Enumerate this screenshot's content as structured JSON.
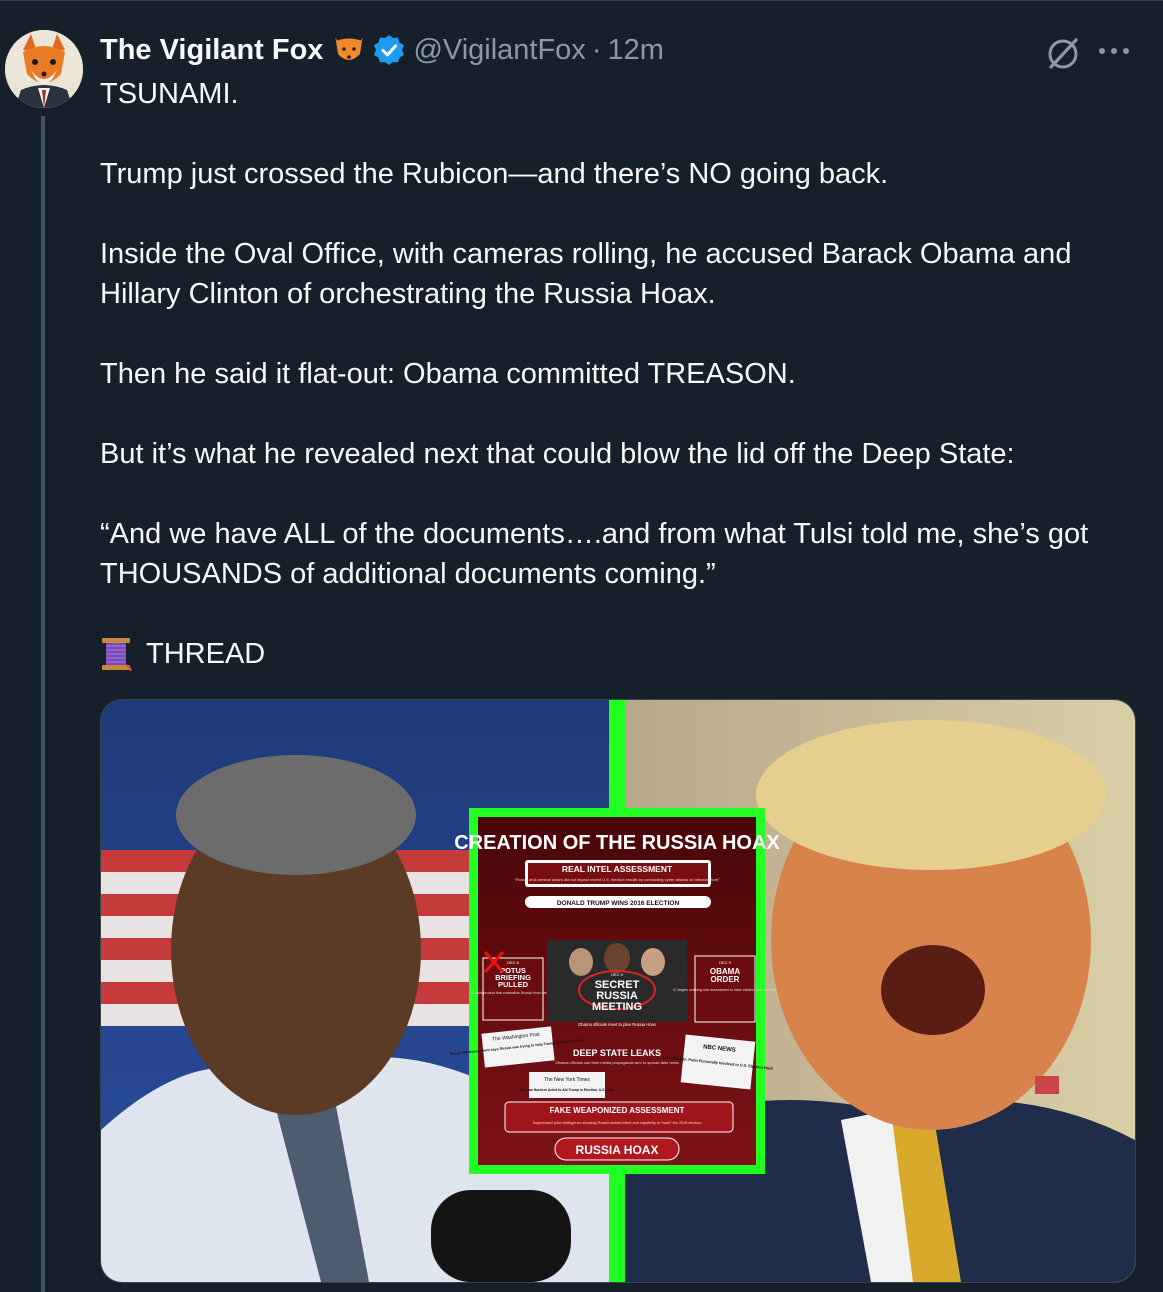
{
  "post": {
    "author_name": "The Vigilant Fox",
    "handle": "@VigilantFox",
    "separator": "·",
    "time": "12m",
    "paragraphs": [
      "TSUNAMI.",
      "Trump just crossed the Rubicon—and there’s NO going back.",
      "Inside the Oval Office, with cameras rolling, he accused Barack Obama and Hillary Clinton of orchestrating the Russia Hoax.",
      "Then he said it flat-out: Obama committed TREASON.",
      "But it’s what he revealed next that could blow the lid off the Deep State:",
      "“And we have ALL of the documents….and from what Tulsi told me, she’s got THOUSANDS of additional documents coming.”"
    ],
    "thread_label": "THREAD"
  },
  "icons": {
    "avatar": "fox-avatar",
    "name_emoji": "fox-face-icon",
    "verified": "verified-badge-icon",
    "grok": "grok-icon",
    "more": "more-dots-icon",
    "thread": "spool-of-thread-icon"
  },
  "colors": {
    "background": "#15202b",
    "text": "#f7f9f9",
    "muted": "#8b98a5",
    "verified_blue": "#1d9bf0",
    "green_frame": "#22ff22",
    "inset_red": "#6b0d10"
  },
  "infographic": {
    "title": "CREATION OF THE RUSSIA HOAX",
    "real_intel": "REAL INTEL ASSESSMENT",
    "real_intel_sub": "“Russia and criminal actors did not impact recent U.S. election results by conducting cyber attacks on infrastructure”",
    "trump_wins": "DONALD TRUMP WINS 2016 ELECTION",
    "left_date": "DEC 8",
    "left_title_1": "POTUS",
    "left_title_2": "BRIEFING",
    "left_title_3": "PULLED",
    "left_sub": "IC pulls product that contradicts Russia Hoax narrative",
    "center_date": "DEC 9",
    "center_title_1": "SECRET",
    "center_title_2": "RUSSIA",
    "center_title_3": "MEETING",
    "center_sub": "Obama officials meet to plan Russia Hoax",
    "right_date": "DEC 9",
    "right_title_1": "OBAMA",
    "right_title_2": "ORDER",
    "right_sub": "IC begins outlining new assessment to claim election was “hacked”",
    "wapo": "The Washington Post",
    "wapo_head": "Secret CIA Assessment says Russia was trying to help Trump win White House",
    "deep_state": "DEEP STATE LEAKS",
    "deep_state_sub": "Obama officials use their media propaganda arm to spread fake news",
    "nyt": "The New York Times",
    "nyt_head": "Russian Hackers Acted to Aid Trump in Election, U.S. Says",
    "nbc": "NBC NEWS",
    "nbc_head": "U.S. Officials: Putin Personally Involved in U.S. Election Hack",
    "fake": "FAKE WEAPONIZED ASSESSMENT",
    "fake_sub": "Suppressed prior intelligence showing Russia lacked intent and capability to “hack” the 2016 election",
    "result": "RUSSIA HOAX"
  }
}
